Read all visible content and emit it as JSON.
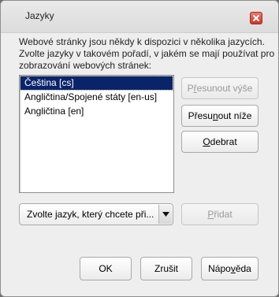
{
  "dialog": {
    "title": "Jazyky",
    "close_icon": "close-icon"
  },
  "description": {
    "line1": "Webové stránky jsou někdy k dispozici v několika jazycích.",
    "line2": "Zvolte jazyky v takovém pořadí, v jakém se mají používat pro",
    "line3": "zobrazování webových stránek:"
  },
  "languages": [
    {
      "label": "Čeština [cs]",
      "selected": true
    },
    {
      "label": "Angličtina/Spojené státy  [en-us]",
      "selected": false
    },
    {
      "label": "Angličtina [en]",
      "selected": false
    }
  ],
  "buttons": {
    "move_up": {
      "pre": "P",
      "key": "ř",
      "post": "esunout výše",
      "disabled": true
    },
    "move_down": {
      "pre": "Přesu",
      "key": "n",
      "post": "out níže",
      "disabled": false
    },
    "remove": {
      "pre": "",
      "key": "O",
      "post": "debrat",
      "disabled": false
    },
    "add": {
      "pre": "",
      "key": "P",
      "post": "řidat",
      "disabled": true
    },
    "ok": "OK",
    "cancel": "Zrušit",
    "help": {
      "pre": "Nápo",
      "key": "v",
      "post": "ěda"
    }
  },
  "language_select": {
    "value": "Zvolte jazyk, který chcete při...",
    "icon": "chevron-down-icon"
  }
}
